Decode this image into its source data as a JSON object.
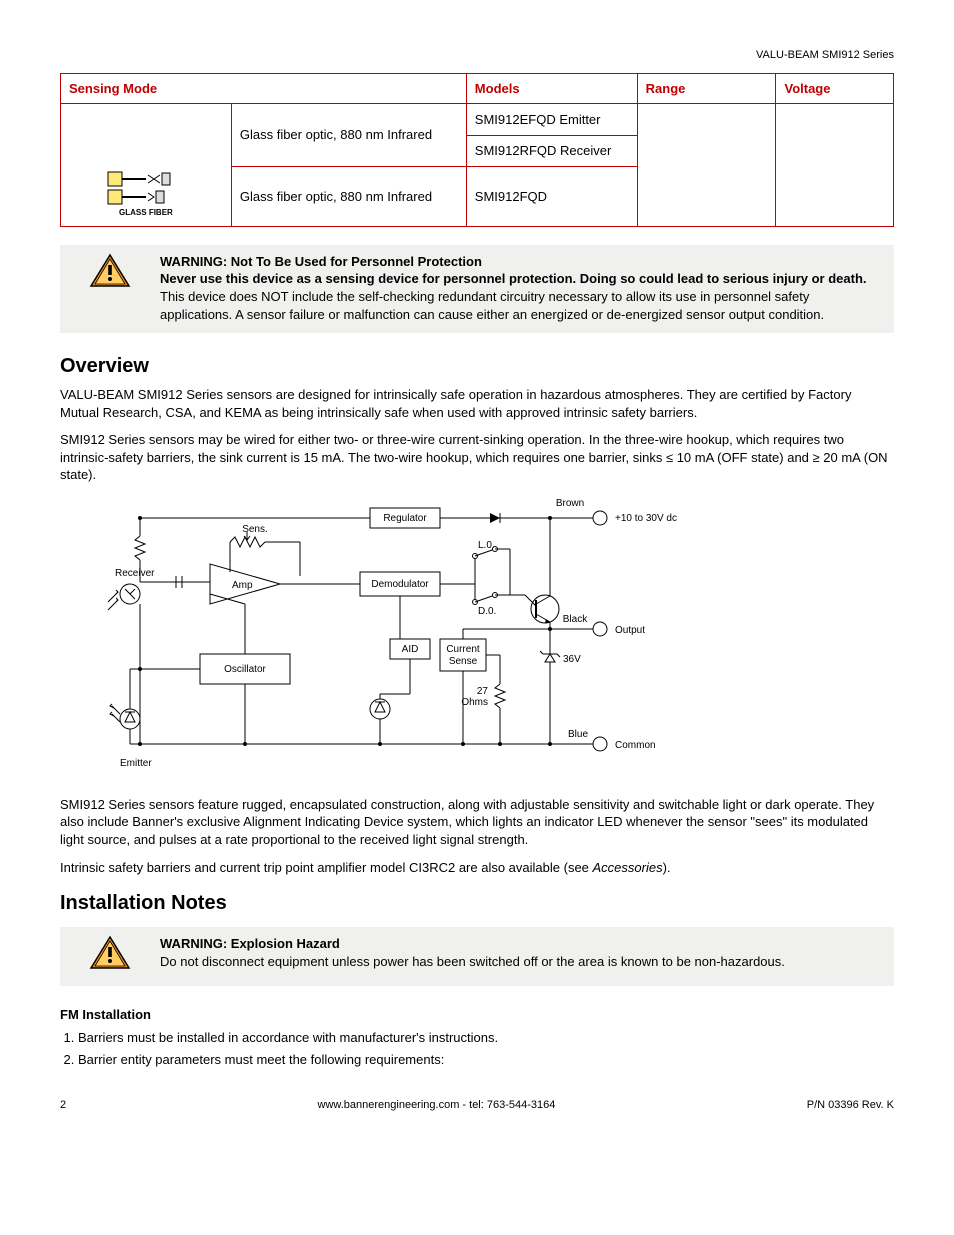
{
  "header": {
    "product_line": "VALU-BEAM SMI912 Series"
  },
  "table": {
    "headers": {
      "sensing": "Sensing Mode",
      "models": "Models",
      "range": "Range",
      "voltage": "Voltage"
    },
    "rows": {
      "r1_desc": "Glass fiber optic, 880 nm Infrared",
      "r1_model_a": "SMI912EFQD Emitter",
      "r1_model_b": "SMI912RFQD Receiver",
      "r2_desc": "Glass fiber optic, 880 nm Infrared",
      "r2_model": "SMI912FQD",
      "glass_fiber_label": "GLASS FIBER"
    }
  },
  "warning1": {
    "title": "WARNING: Not To Be Used for Personnel Protection",
    "lead": "Never use this device as a sensing device for personnel protection. Doing so could lead to serious injury or death.",
    "rest": " This device does NOT include the self-checking redundant circuitry necessary to allow its use in personnel safety applications. A sensor failure or malfunction can cause either an energized or de-energized sensor output condition."
  },
  "overview": {
    "heading": "Overview",
    "p1": "VALU-BEAM SMI912 Series sensors are designed for intrinsically safe operation in hazardous atmospheres. They are certified by Factory Mutual Research, CSA, and KEMA as being intrinsically safe when used with approved intrinsic safety barriers.",
    "p2": "SMI912 Series sensors may be wired for either two- or three-wire current-sinking operation. In the three-wire hookup, which requires two intrinsic-safety barriers, the sink current is 15 mA. The two-wire hookup, which requires one barrier, sinks ≤ 10 mA (OFF state) and ≥ 20 mA (ON state).",
    "p3": "SMI912 Series sensors feature rugged, encapsulated construction, along with adjustable sensitivity and switchable light or dark operate. They also include Banner's exclusive Alignment Indicating Device system, which lights an indicator LED whenever the sensor \"sees\" its modulated light source, and pulses at a rate proportional to the received light signal strength.",
    "p4_a": "Intrinsic safety barriers and current trip point amplifier model CI3RC2 are also available (see ",
    "p4_em": "Accessories",
    "p4_b": ")."
  },
  "diagram": {
    "labels": {
      "regulator": "Regulator",
      "sens": "Sens.",
      "brown": "Brown",
      "supply": "+10 to 30V dc",
      "receiver": "Receiver",
      "amp": "Amp",
      "demodulator": "Demodulator",
      "lo": "L.0.",
      "do": "D.0.",
      "black": "Black",
      "output": "Output",
      "aid": "AID",
      "current_sense": "Current\nSense",
      "ohms": "27\nOhms",
      "v36": "36V",
      "oscillator": "Oscillator",
      "blue": "Blue",
      "common": "Common",
      "emitter": "Emitter"
    }
  },
  "install": {
    "heading": "Installation Notes"
  },
  "warning2": {
    "title": "WARNING: Explosion Hazard",
    "body": "Do not disconnect equipment unless power has been switched off or the area is known to be non-hazardous."
  },
  "fm": {
    "heading": "FM Installation",
    "item1": "Barriers must be installed in accordance with manufacturer's instructions.",
    "item2": "Barrier entity parameters must meet the following requirements:"
  },
  "footer": {
    "page": "2",
    "center": "www.bannerengineering.com - tel: 763-544-3164",
    "right": "P/N 03396 Rev. K"
  }
}
